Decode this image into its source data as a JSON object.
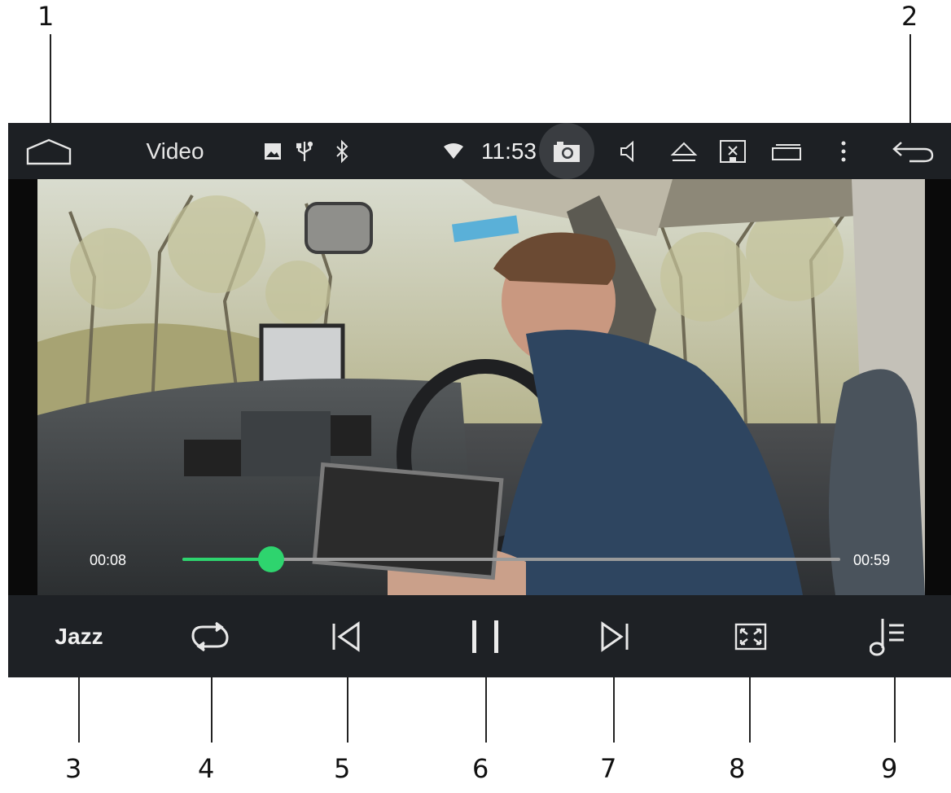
{
  "callouts": [
    "1",
    "2",
    "3",
    "4",
    "5",
    "6",
    "7",
    "8",
    "9"
  ],
  "statusbar": {
    "title": "Video",
    "time": "11:53",
    "icons": [
      "home-icon",
      "image-icon",
      "usb-icon",
      "bluetooth-icon",
      "wifi-icon",
      "camera-icon",
      "volume-icon",
      "eject-icon",
      "screen-off-icon",
      "recent-apps-icon",
      "more-icon",
      "back-icon"
    ]
  },
  "player": {
    "elapsed": "00:08",
    "duration": "00:59",
    "progress": 0.135
  },
  "controls": {
    "eq_label": "Jazz",
    "icons": [
      "repeat-icon",
      "previous-icon",
      "pause-icon",
      "next-icon",
      "fullscreen-icon",
      "playlist-icon"
    ]
  },
  "colors": {
    "accent": "#2ed46e",
    "bar": "#1e2125"
  }
}
